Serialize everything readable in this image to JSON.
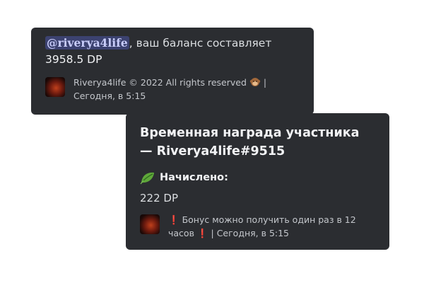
{
  "balance_card": {
    "mention": "@riverya4life",
    "message_suffix": ", ваш баланс составляет",
    "balance_value": "3958.5 DP",
    "footer_copyright": "Riverya4life © 2022 All rights reserved",
    "footer_separator": "|",
    "footer_timestamp": "Сегодня, в 5:15",
    "footer_icon": "monkey-emoji-icon",
    "avatar_icon": "avatar-image"
  },
  "reward_card": {
    "title_line1": "Временная награда участника",
    "title_line2": "— Riverya4life#9515",
    "field_icon": "leaf-emoji-icon",
    "field_name": "Начислено:",
    "field_value": "222 DP",
    "footer_notice_part1": "Бонус можно получить один раз в 12",
    "footer_notice_part2": "часов",
    "footer_separator": "|",
    "footer_timestamp": "Сегодня, в 5:15",
    "notice_icon": "exclamation-emoji-icon",
    "avatar_icon": "avatar-image"
  },
  "colors": {
    "card_bg": "#2b2d31",
    "mention_bg": "#3c4270",
    "mention_text": "#c9cdfb",
    "exclamation": "#e0303a"
  }
}
